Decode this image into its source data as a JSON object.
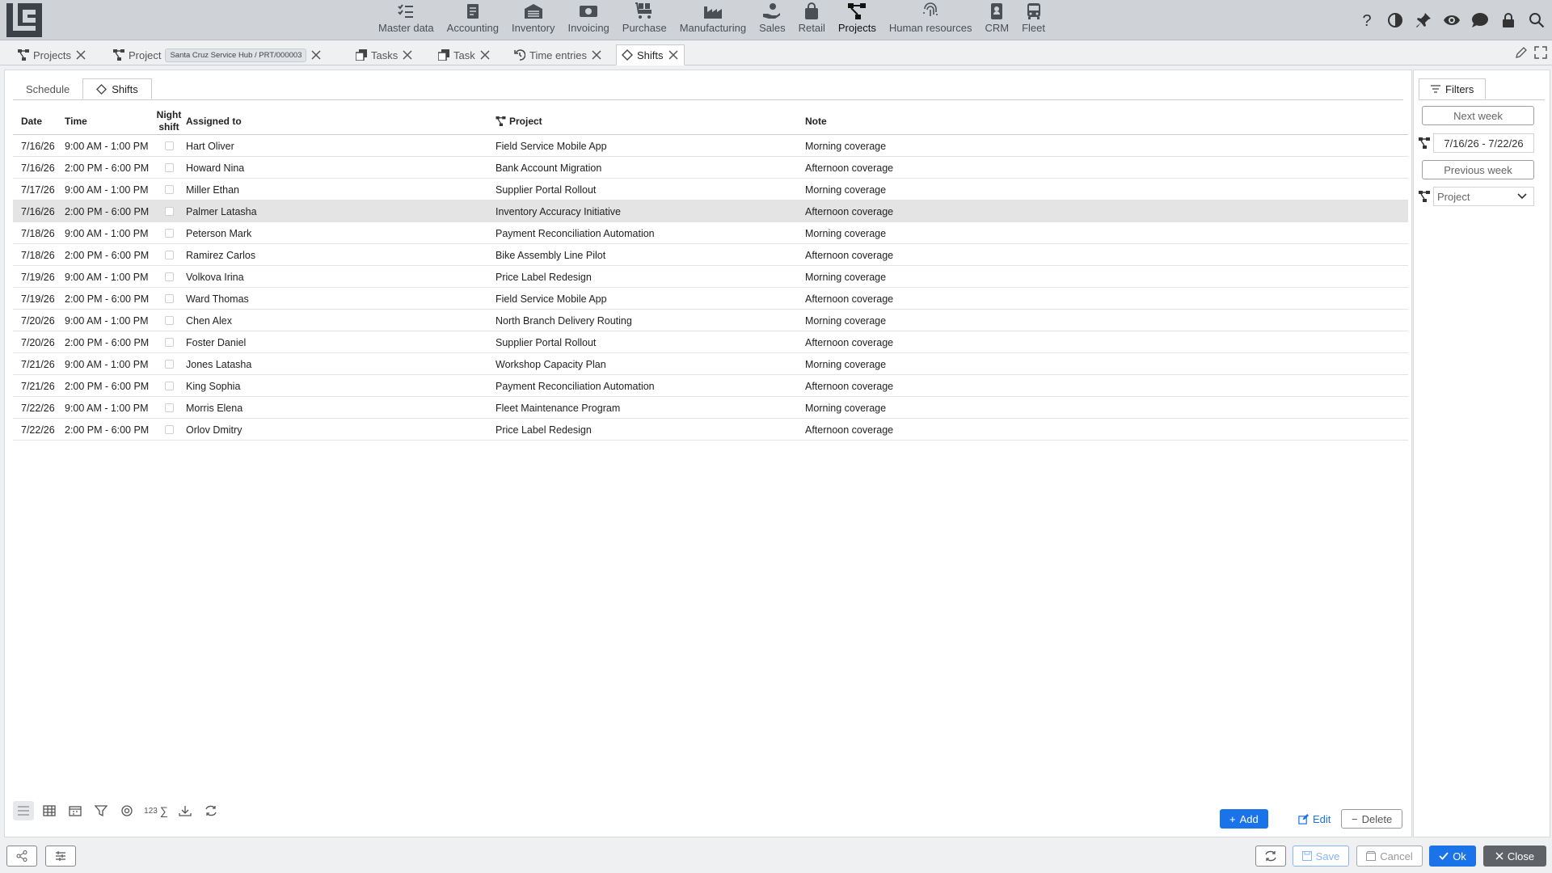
{
  "modules": [
    {
      "label": "Master data",
      "icon": "checklist-icon"
    },
    {
      "label": "Accounting",
      "icon": "ledger-icon"
    },
    {
      "label": "Inventory",
      "icon": "warehouse-icon"
    },
    {
      "label": "Invoicing",
      "icon": "cash-icon"
    },
    {
      "label": "Purchase",
      "icon": "cart-icon"
    },
    {
      "label": "Manufacturing",
      "icon": "factory-icon"
    },
    {
      "label": "Sales",
      "icon": "hand-coin-icon"
    },
    {
      "label": "Retail",
      "icon": "shopping-bag-icon"
    },
    {
      "label": "Projects",
      "icon": "project-tree-icon"
    },
    {
      "label": "Human resources",
      "icon": "fingerprint-icon"
    },
    {
      "label": "CRM",
      "icon": "contact-card-icon"
    },
    {
      "label": "Fleet",
      "icon": "bus-icon"
    }
  ],
  "active_module": "Projects",
  "top_actions": [
    "help-icon",
    "contrast-icon",
    "pin-icon",
    "eye-icon",
    "chat-icon",
    "lock-icon",
    "search-icon"
  ],
  "tabs": [
    {
      "label": "Projects",
      "icon": "project-tree-icon"
    },
    {
      "label": "Project",
      "icon": "project-tree-icon",
      "chip": "Santa Cruz Service Hub / PRT/000003"
    },
    {
      "label": "Tasks",
      "icon": "copy-icon"
    },
    {
      "label": "Task",
      "icon": "copy-icon"
    },
    {
      "label": "Time entries",
      "icon": "history-icon"
    },
    {
      "label": "Shifts",
      "icon": "diamond-icon"
    }
  ],
  "subtabs": {
    "schedule": "Schedule",
    "shifts": "Shifts"
  },
  "columns": {
    "date": "Date",
    "time": "Time",
    "night1": "Night",
    "night2": "shift",
    "assigned": "Assigned to",
    "project": "Project",
    "note": "Note"
  },
  "rows": [
    {
      "date": "7/16/26",
      "time": "9:00 AM - 1:00 PM",
      "night": false,
      "assigned": "Hart Oliver",
      "project": "Field Service Mobile App",
      "note": "Morning coverage"
    },
    {
      "date": "7/16/26",
      "time": "2:00 PM - 6:00 PM",
      "night": false,
      "assigned": "Howard Nina",
      "project": "Bank Account Migration",
      "note": "Afternoon coverage"
    },
    {
      "date": "7/17/26",
      "time": "9:00 AM - 1:00 PM",
      "night": false,
      "assigned": "Miller Ethan",
      "project": "Supplier Portal Rollout",
      "note": "Morning coverage"
    },
    {
      "date": "7/16/26",
      "time": "2:00 PM - 6:00 PM",
      "night": false,
      "assigned": "Palmer Latasha",
      "project": "Inventory Accuracy Initiative",
      "note": "Afternoon coverage",
      "selected": true
    },
    {
      "date": "7/18/26",
      "time": "9:00 AM - 1:00 PM",
      "night": false,
      "assigned": "Peterson Mark",
      "project": "Payment Reconciliation Automation",
      "note": "Morning coverage"
    },
    {
      "date": "7/18/26",
      "time": "2:00 PM - 6:00 PM",
      "night": false,
      "assigned": "Ramirez Carlos",
      "project": "Bike Assembly Line Pilot",
      "note": "Afternoon coverage"
    },
    {
      "date": "7/19/26",
      "time": "9:00 AM - 1:00 PM",
      "night": false,
      "assigned": "Volkova Irina",
      "project": "Price Label Redesign",
      "note": "Morning coverage"
    },
    {
      "date": "7/19/26",
      "time": "2:00 PM - 6:00 PM",
      "night": false,
      "assigned": "Ward Thomas",
      "project": "Field Service Mobile App",
      "note": "Afternoon coverage"
    },
    {
      "date": "7/20/26",
      "time": "9:00 AM - 1:00 PM",
      "night": false,
      "assigned": "Chen Alex",
      "project": "North Branch Delivery Routing",
      "note": "Morning coverage"
    },
    {
      "date": "7/20/26",
      "time": "2:00 PM - 6:00 PM",
      "night": false,
      "assigned": "Foster Daniel",
      "project": "Supplier Portal Rollout",
      "note": "Afternoon coverage"
    },
    {
      "date": "7/21/26",
      "time": "9:00 AM - 1:00 PM",
      "night": false,
      "assigned": "Jones Latasha",
      "project": "Workshop Capacity Plan",
      "note": "Morning coverage"
    },
    {
      "date": "7/21/26",
      "time": "2:00 PM - 6:00 PM",
      "night": false,
      "assigned": "King Sophia",
      "project": "Payment Reconciliation Automation",
      "note": "Afternoon coverage"
    },
    {
      "date": "7/22/26",
      "time": "9:00 AM - 1:00 PM",
      "night": false,
      "assigned": "Morris Elena",
      "project": "Fleet Maintenance Program",
      "note": "Morning coverage"
    },
    {
      "date": "7/22/26",
      "time": "2:00 PM - 6:00 PM",
      "night": false,
      "assigned": "Orlov Dmitry",
      "project": "Price Label Redesign",
      "note": "Afternoon coverage"
    }
  ],
  "bottom_tools": {
    "count_label": "123"
  },
  "actions": {
    "add": "Add",
    "edit": "Edit",
    "delete": "Delete"
  },
  "filters": {
    "tab": "Filters",
    "next_week": "Next week",
    "range": "7/16/26 - 7/22/26",
    "previous_week": "Previous week",
    "project_placeholder": "Project"
  },
  "footer": {
    "save": "Save",
    "cancel": "Cancel",
    "ok": "Ok",
    "close": "Close"
  },
  "colors": {
    "primary": "#1a73e8",
    "selected_row": "#e4e4e4",
    "topbar": "#cfd3d8",
    "close_button": "#5f6368"
  }
}
